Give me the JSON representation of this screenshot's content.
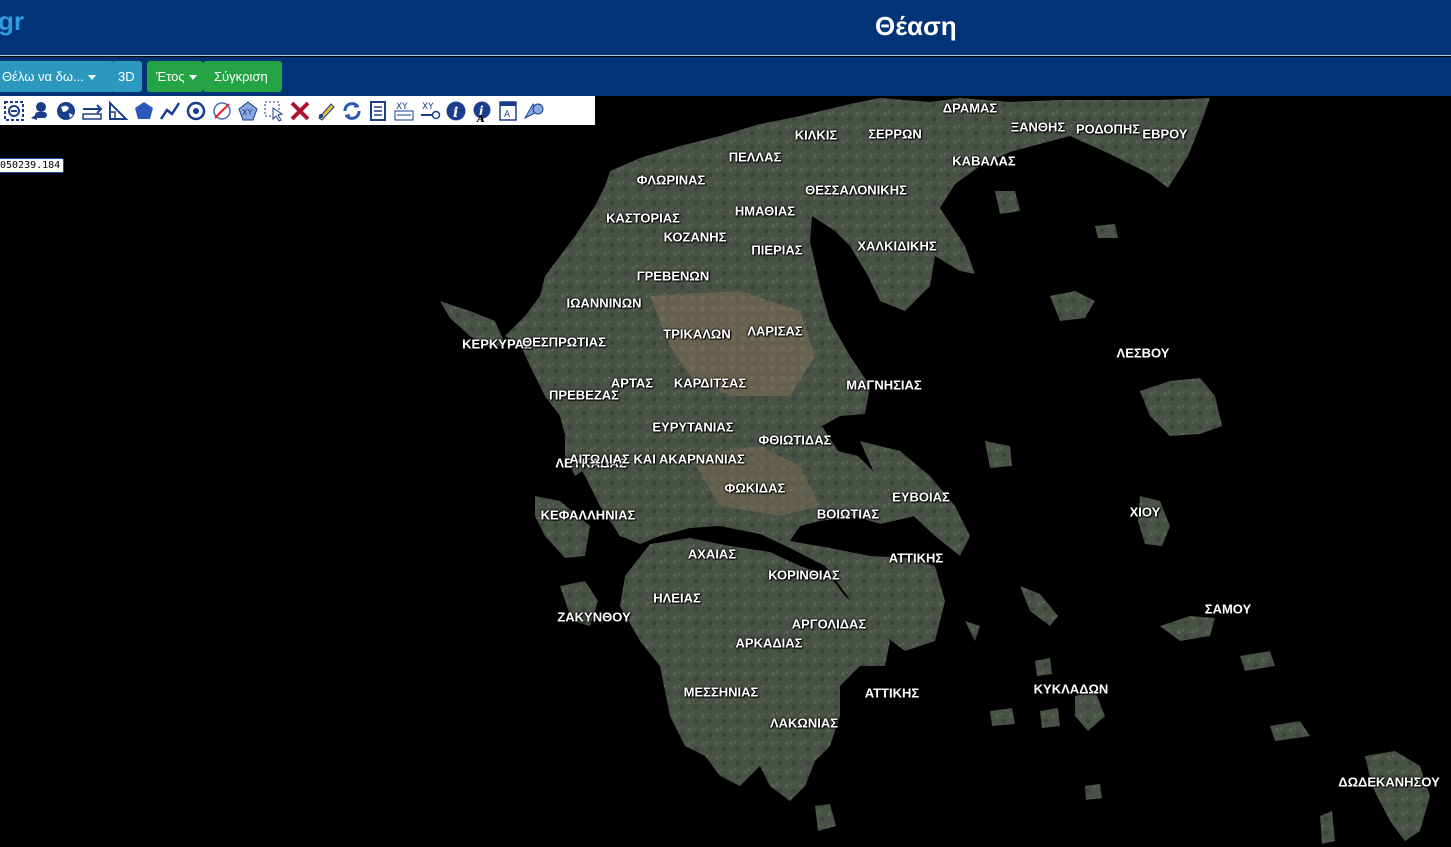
{
  "header": {
    "logo_text": "gr",
    "title": "Θέαση",
    "colors": {
      "background": "#003476",
      "logo": "#2e9be4"
    }
  },
  "navbar": {
    "view_menu_label": "Θέλω να δω...",
    "view_3d_label": "3D",
    "year_menu_label": "Έτος",
    "compare_label": "Σύγκριση"
  },
  "toolbar": {
    "tools": [
      "zoom-extent-icon",
      "pan-user-icon",
      "world-icon",
      "measure-distance-icon",
      "measure-angle-icon",
      "polygon-icon",
      "polyline-icon",
      "circle-target-icon",
      "no-draw-icon",
      "xy-point-icon",
      "select-icon",
      "clear-icon",
      "edit-icon",
      "refresh-icon",
      "document-icon",
      "xy-list-icon",
      "xy-goto-icon",
      "info-icon",
      "info-text-icon",
      "map-label-icon",
      "shape-select-icon"
    ]
  },
  "coordinates": {
    "readout": "050239.184"
  },
  "map": {
    "labels": [
      "ΔΡΑΜΑΣ",
      "ΞΑΝΘΗΣ",
      "ΡΟΔΟΠΗΣ",
      "ΕΒΡΟΥ",
      "ΚΙΛΚΙΣ",
      "ΣΕΡΡΩΝ",
      "ΠΕΛΛΑΣ",
      "ΚΑΒΑΛΑΣ",
      "ΦΛΩΡΙΝΑΣ",
      "ΘΕΣΣΑΛΟΝΙΚΗΣ",
      "ΗΜΑΘΙΑΣ",
      "ΚΑΣΤΟΡΙΑΣ",
      "ΚΟΖΑΝΗΣ",
      "ΠΙΕΡΙΑΣ",
      "ΧΑΛΚΙΔΙΚΗΣ",
      "ΓΡΕΒΕΝΩΝ",
      "ΙΩΑΝΝΙΝΩΝ",
      "ΤΡΙΚΑΛΩΝ",
      "ΛΑΡΙΣΑΣ",
      "ΚΕΡΚΥΡΑΣ",
      "ΘΕΣΠΡΩΤΙΑΣ",
      "ΛΕΣΒΟΥ",
      "ΑΡΤΑΣ",
      "ΚΑΡΔΙΤΣΑΣ",
      "ΜΑΓΝΗΣΙΑΣ",
      "ΠΡΕΒΕΖΑΣ",
      "ΕΥΡΥΤΑΝΙΑΣ",
      "ΦΘΙΩΤΙΔΑΣ",
      "ΛΕΥΚΑΔΑΣ",
      "ΑΙΤΩΛΙΑΣ ΚΑΙ ΑΚΑΡΝΑΝΙΑΣ",
      "ΦΩΚΙΔΑΣ",
      "ΕΥΒΟΙΑΣ",
      "ΧΙΟΥ",
      "ΚΕΦΑΛΛΗΝΙΑΣ",
      "ΒΟΙΩΤΙΑΣ",
      "ΑΧΑΙΑΣ",
      "ΑΤΤΙΚΗΣ",
      "ΚΟΡΙΝΘΙΑΣ",
      "ΗΛΕΙΑΣ",
      "ΣΑΜΟΥ",
      "ΖΑΚΥΝΘΟΥ",
      "ΑΡΓΟΛΙΔΑΣ",
      "ΑΡΚΑΔΙΑΣ",
      "ΜΕΣΣΗΝΙΑΣ",
      "ΑΤΤΙΚΗΣ",
      "ΚΥΚΛΑΔΩΝ",
      "ΛΑΚΩΝΙΑΣ",
      "ΔΩΔΕΚΑΝΗΣΟΥ"
    ],
    "colors": {
      "sea": "#000000",
      "land": "#4a5448",
      "land_dark": "#3a4438",
      "plain": "#6b6650"
    }
  }
}
